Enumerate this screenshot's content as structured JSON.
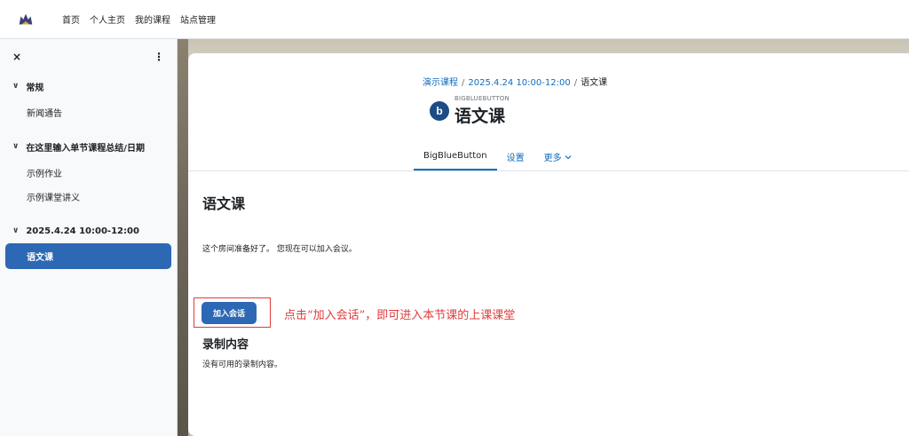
{
  "navbar": {
    "logo_icon": "moodle-logo-icon",
    "links": [
      "首页",
      "个人主页",
      "我的课程",
      "站点管理"
    ]
  },
  "drawer": {
    "close_glyph": "×",
    "menu_glyph": "⋮",
    "sections": [
      {
        "title": "常规",
        "items": [
          "新闻通告"
        ]
      },
      {
        "title": "在这里输入单节课程总结/日期",
        "items": [
          "示例作业",
          "示例课堂讲义"
        ]
      },
      {
        "title": "2025.4.24 10:00-12:00",
        "items": [
          "语文课"
        ]
      }
    ],
    "active_item": "语文课"
  },
  "breadcrumb": [
    "演示课程",
    "2025.4.24 10:00-12:00",
    "语文课"
  ],
  "module": {
    "type_label": "BIGBLUEBUTTON",
    "title": "语文课",
    "icon_letter": "b"
  },
  "tabs": [
    "BigBlueButton",
    "设置",
    "更多"
  ],
  "content": {
    "heading": "语文课",
    "status_text": "这个房间准备好了。 您现在可以加入会议。",
    "join_label": "加入会话",
    "annotation": "点击“加入会话”，即可进入本节课的上课课堂",
    "recordings_heading": "录制内容",
    "recordings_text": "没有可用的录制内容。"
  },
  "colors": {
    "primary": "#2d68b4",
    "link": "#0f6cbf",
    "annotation_red": "#e03c3c"
  }
}
